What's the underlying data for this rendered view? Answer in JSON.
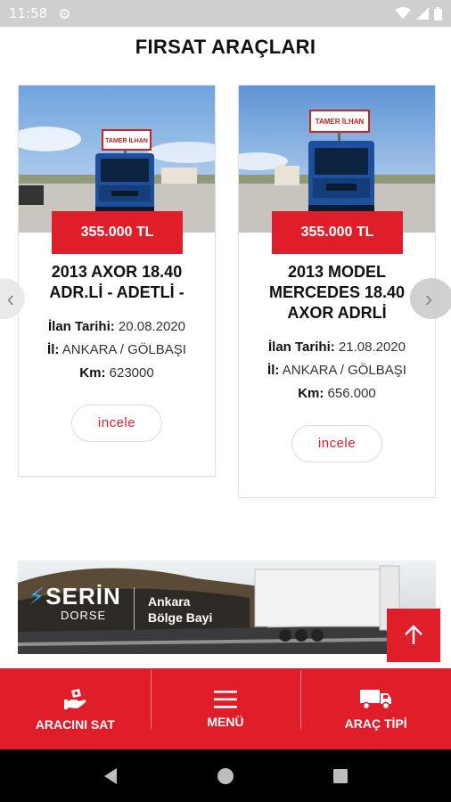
{
  "status_bar": {
    "time": "11:58"
  },
  "page": {
    "title": "FIRSAT ARAÇLARI"
  },
  "cards": [
    {
      "price": "355.000 TL",
      "title": "2013 AXOR 18.40 ADR.Lİ - ADETLİ -",
      "date_label": "İlan Tarihi:",
      "date": "20.08.2020",
      "city_label": "İl:",
      "city": "ANKARA / GÖLBAŞI",
      "km_label": "Km:",
      "km": "623000",
      "button": "incele",
      "photo_sign": "TAMER İLHAN"
    },
    {
      "price": "355.000 TL",
      "title": "2013 MODEL MERCEDES 18.40 AXOR ADRLİ",
      "date_label": "İlan Tarihi:",
      "date": "21.08.2020",
      "city_label": "İl:",
      "city": "ANKARA / GÖLBAŞI",
      "km_label": "Km:",
      "km": "656.000",
      "button": "incele",
      "photo_sign": "TAMER İLHAN"
    }
  ],
  "banner": {
    "brand": "SERİN",
    "brand_sub": "DORSE",
    "line1": "Ankara",
    "line2": "Bölge Bayi"
  },
  "bottom_nav": [
    {
      "label": "ARACINI SAT",
      "icon": "sell-vehicle-icon"
    },
    {
      "label": "MENÜ",
      "icon": "menu-icon"
    },
    {
      "label": "ARAÇ TİPİ",
      "icon": "truck-icon"
    }
  ],
  "colors": {
    "accent": "#e01e2a",
    "status_bar": "#cfcfcf",
    "nav_bar": "#000000"
  }
}
